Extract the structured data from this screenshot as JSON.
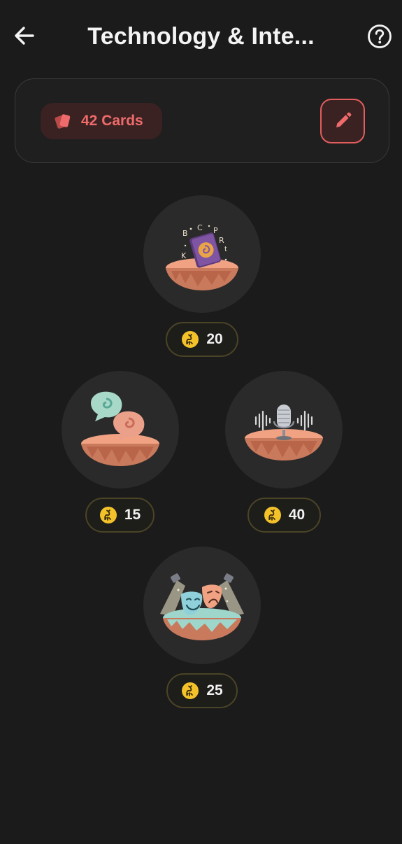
{
  "header": {
    "title": "Technology & Inte...",
    "back_icon": "arrow-left-icon",
    "help_icon": "question-circle-icon"
  },
  "deck": {
    "cards_label": "42 Cards",
    "cards_icon": "cards-icon",
    "edit_icon": "pencil-icon"
  },
  "levels": [
    {
      "illustration": "spell-book-icon",
      "price": "20",
      "currency_icon": "scorpion-coin-icon"
    },
    {
      "illustration": "speech-swirl-icon",
      "price": "15",
      "currency_icon": "scorpion-coin-icon"
    },
    {
      "illustration": "microphone-icon",
      "price": "40",
      "currency_icon": "scorpion-coin-icon"
    },
    {
      "illustration": "theater-masks-icon",
      "price": "25",
      "currency_icon": "scorpion-coin-icon"
    }
  ],
  "colors": {
    "background": "#1b1b1b",
    "accent_red": "#ef6b6b",
    "coin_yellow": "#f3c22b",
    "island_pink": "#f0a283"
  }
}
